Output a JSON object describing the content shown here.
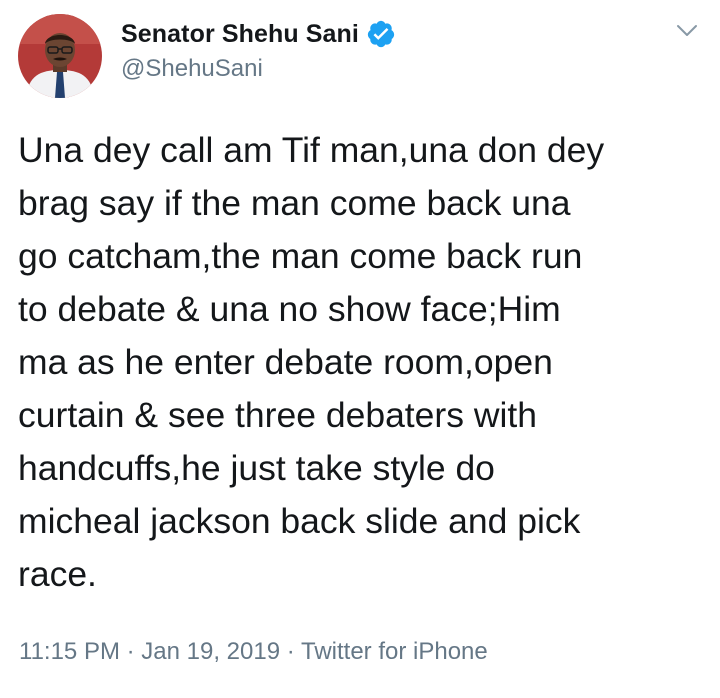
{
  "author": {
    "display_name": "Senator Shehu Sani",
    "handle": "@ShehuSani",
    "verified": true,
    "verified_icon": "verified-badge-icon",
    "verified_color": "#1da1f2"
  },
  "menu_icon": "chevron-down-icon",
  "tweet": {
    "text": "Una dey call am Tif man,una don dey\nbrag say if the man come back una\ngo catcham,the man come back run\nto debate & una no show face;Him\nma as he enter debate room,open\ncurtain & see three debaters with\nhandcuffs,he just take style do\nmicheal jackson back slide and pick\nrace."
  },
  "meta": {
    "time": "11:15 PM",
    "separator": " · ",
    "date": "Jan 19, 2019",
    "source": "Twitter for iPhone"
  },
  "colors": {
    "text": "#14171a",
    "secondary": "#657786",
    "accent": "#1da1f2"
  }
}
